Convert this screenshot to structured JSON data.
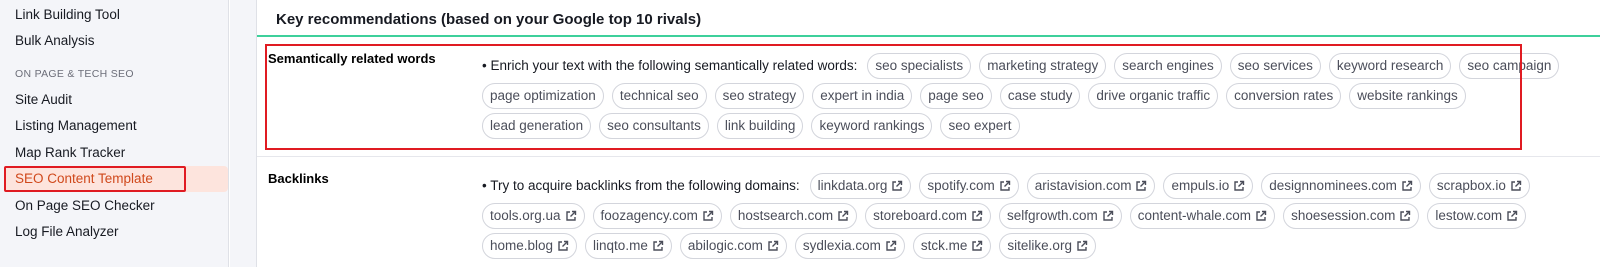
{
  "sidebar": {
    "items_top": [
      {
        "label": "Link Building Tool"
      },
      {
        "label": "Bulk Analysis"
      }
    ],
    "section_label": "ON PAGE & TECH SEO",
    "items": [
      {
        "label": "Site Audit"
      },
      {
        "label": "Listing Management"
      },
      {
        "label": "Map Rank Tracker"
      },
      {
        "label": "SEO Content Template"
      },
      {
        "label": "On Page SEO Checker"
      },
      {
        "label": "Log File Analyzer"
      }
    ]
  },
  "card": {
    "title": "Key recommendations (based on your Google top 10 rivals)"
  },
  "semantic": {
    "label": "Semantically related words",
    "lead": "• Enrich your text with the following semantically related words:",
    "tags": [
      "seo specialists",
      "marketing strategy",
      "search engines",
      "seo services",
      "keyword research",
      "seo campaign",
      "page optimization",
      "technical seo",
      "seo strategy",
      "expert in india",
      "page seo",
      "case study",
      "drive organic traffic",
      "conversion rates",
      "website rankings",
      "lead generation",
      "seo consultants",
      "link building",
      "keyword rankings",
      "seo expert"
    ]
  },
  "backlinks": {
    "label": "Backlinks",
    "lead": "• Try to acquire backlinks from the following domains:",
    "domains": [
      "linkdata.org",
      "spotify.com",
      "aristavision.com",
      "empuls.io",
      "designnominees.com",
      "scrapbox.io",
      "tools.org.ua",
      "foozagency.com",
      "hostsearch.com",
      "storeboard.com",
      "selfgrowth.com",
      "content-whale.com",
      "shoesession.com",
      "lestow.com",
      "home.blog",
      "linqto.me",
      "abilogic.com",
      "sydlexia.com",
      "stck.me",
      "sitelike.org"
    ],
    "link_icon": "external-link-icon"
  },
  "colors": {
    "accent_green": "#3ed09b",
    "highlight_red": "#e01b22",
    "active_bg": "#fde4dd",
    "active_text": "#d0491c"
  }
}
